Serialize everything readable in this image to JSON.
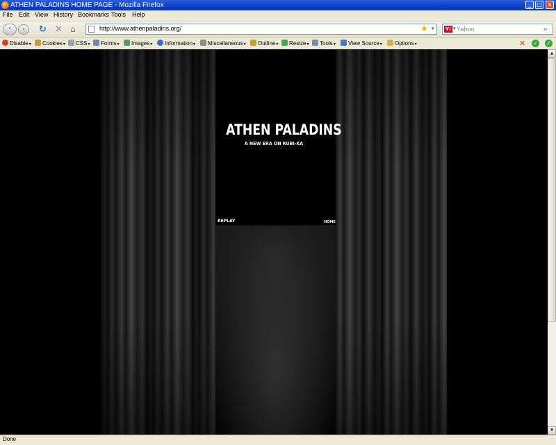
{
  "window": {
    "title": "ATHEN PALADINS HOME PAGE - Mozilla Firefox",
    "min_icon": "_",
    "max_icon": "□",
    "close_icon": "×"
  },
  "menu": {
    "items": [
      {
        "label": "File"
      },
      {
        "label": "Edit"
      },
      {
        "label": "View"
      },
      {
        "label": "History"
      },
      {
        "label": "Bookmarks"
      },
      {
        "label": "Tools"
      },
      {
        "label": "Help"
      }
    ]
  },
  "nav": {
    "back_icon": "‹",
    "forward_icon": "›",
    "reload_icon": "↻",
    "stop_icon": "✕",
    "home_icon": "⌂",
    "url": "http://www.athenpaladins.org/",
    "bookmark_icon": "★",
    "url_dropdown_icon": "▾",
    "search_engine": "Y!",
    "search_placeholder": "Yahoo",
    "search_icon": "⌕"
  },
  "devbar": {
    "items": [
      {
        "label": "Disable",
        "color": "#d83b2a"
      },
      {
        "label": "Cookies",
        "color": "#c89a3a"
      },
      {
        "label": "CSS",
        "color": "#9aa0a8"
      },
      {
        "label": "Forms",
        "color": "#6b8ab8"
      },
      {
        "label": "Images",
        "color": "#5a9a6a"
      },
      {
        "label": "Information",
        "color": "#3a6ac8"
      },
      {
        "label": "Miscellaneous",
        "color": "#8a8a8a"
      },
      {
        "label": "Outline",
        "color": "#c8a030"
      },
      {
        "label": "Resize",
        "color": "#4aa84a"
      },
      {
        "label": "Tools",
        "color": "#7a8ab0"
      },
      {
        "label": "View Source",
        "color": "#4a78c0"
      },
      {
        "label": "Options",
        "color": "#d8b040"
      }
    ],
    "status": {
      "error_icon": "✕",
      "css_ok_icon": "✓",
      "js_ok_icon": "✓"
    }
  },
  "site": {
    "title": "ATHEN PALADINS",
    "tagline": "A NEW ERA ON RUBI-KA",
    "replay_label": "REPLAY",
    "home_label": "HOME"
  },
  "scroll": {
    "up_icon": "▲",
    "down_icon": "▼"
  },
  "status": {
    "text": "Done"
  }
}
